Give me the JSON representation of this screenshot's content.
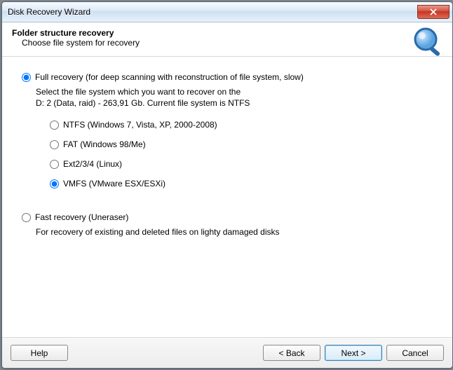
{
  "title": "Disk Recovery Wizard",
  "header": {
    "title": "Folder structure recovery",
    "sub": "Choose file system for recovery"
  },
  "full": {
    "label": "Full recovery (for deep scanning with reconstruction of file system, slow)",
    "desc1": "Select the file system which you want to recover on the",
    "desc2": "D: 2 (Data, raid) - 263,91 Gb. Current file system is NTFS"
  },
  "fs": {
    "ntfs": "NTFS (Windows 7, Vista, XP, 2000-2008)",
    "fat": "FAT (Windows 98/Me)",
    "ext": "Ext2/3/4 (Linux)",
    "vmfs": "VMFS (VMware ESX/ESXi)"
  },
  "fast": {
    "label": "Fast recovery (Uneraser)",
    "desc": "For recovery of existing and deleted files on lighty damaged disks"
  },
  "buttons": {
    "help": "Help",
    "back": "< Back",
    "next": "Next >",
    "cancel": "Cancel"
  }
}
